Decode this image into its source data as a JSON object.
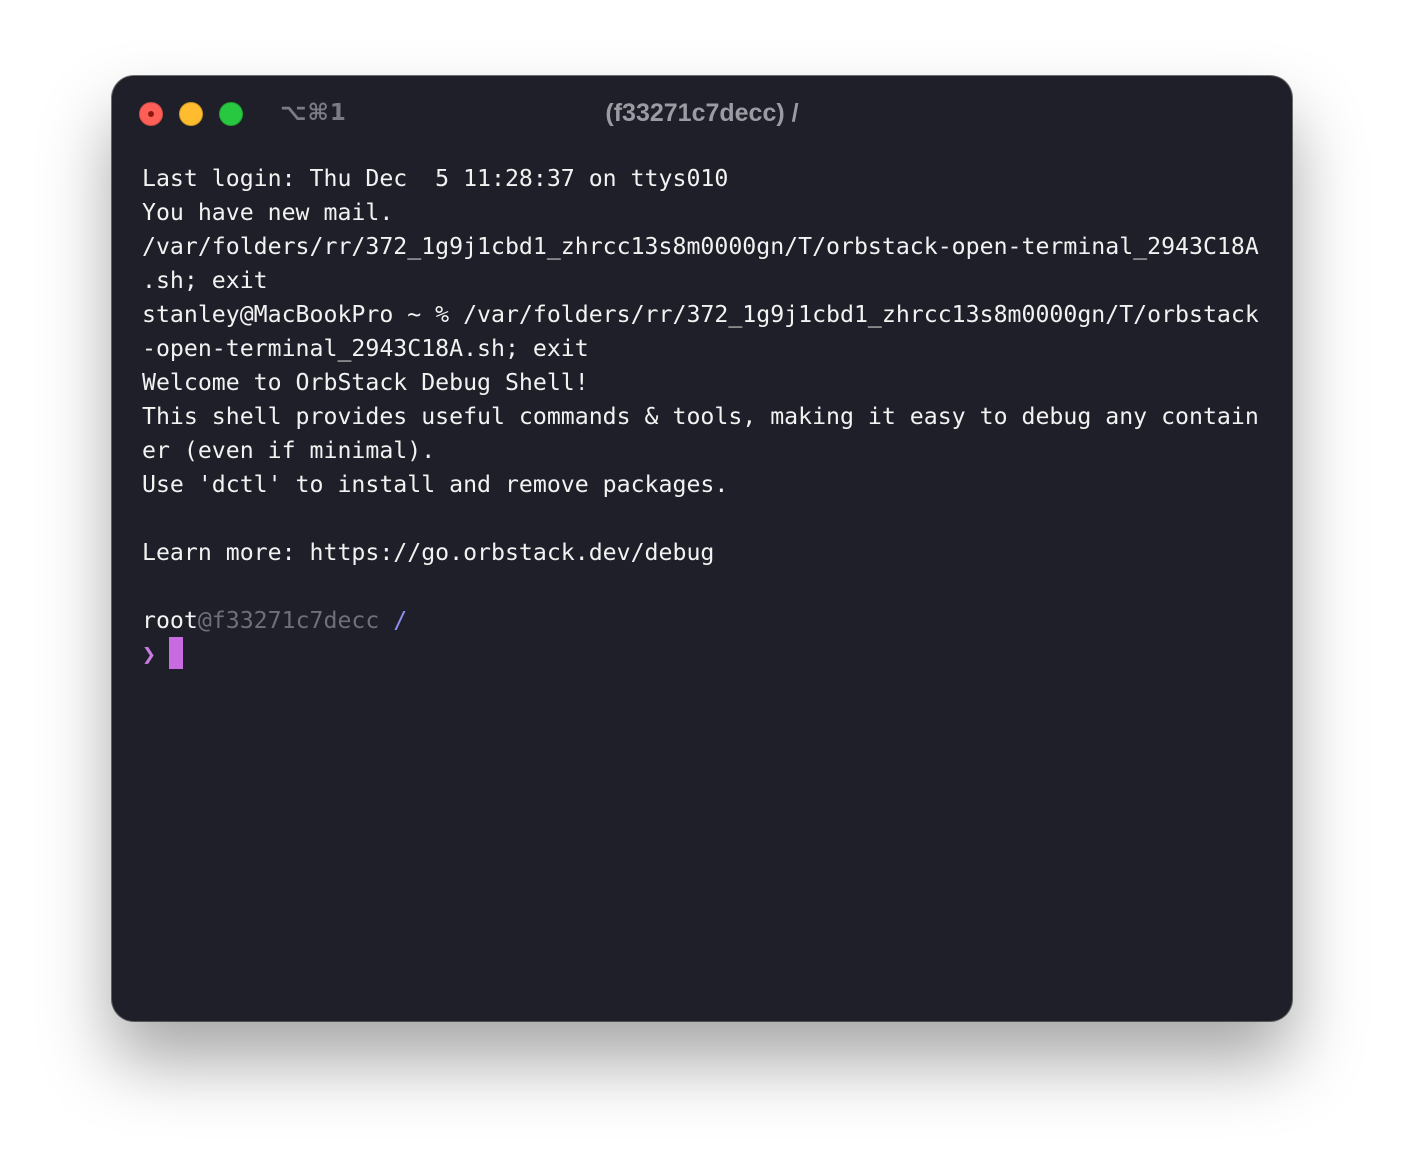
{
  "window": {
    "shortcut": "⌥⌘1",
    "title": "(f33271c7decc) /"
  },
  "terminal": {
    "lines": [
      "Last login: Thu Dec  5 11:28:37 on ttys010",
      "You have new mail.",
      "/var/folders/rr/372_1g9j1cbd1_zhrcc13s8m0000gn/T/orbstack-open-terminal_2943C18A",
      ".sh; exit",
      "stanley@MacBookPro ~ % /var/folders/rr/372_1g9j1cbd1_zhrcc13s8m0000gn/T/orbstack",
      "-open-terminal_2943C18A.sh; exit",
      "Welcome to OrbStack Debug Shell!",
      "This shell provides useful commands & tools, making it easy to debug any contain",
      "er (even if minimal).",
      "Use 'dctl' to install and remove packages.",
      "",
      "Learn more: https://go.orbstack.dev/debug",
      ""
    ],
    "prompt": {
      "user": "root",
      "host": "@f33271c7decc",
      "path": " /",
      "symbol": "❯"
    }
  },
  "colors": {
    "window_bg": "#1e1f28",
    "text": "#f2f2f2",
    "host": "#6e6f79",
    "path": "#8f8ef0",
    "prompt_symbol": "#c97ce0",
    "cursor": "#c86be0",
    "close": "#ff5f57",
    "minimize": "#febc2e",
    "zoom": "#28c840"
  }
}
